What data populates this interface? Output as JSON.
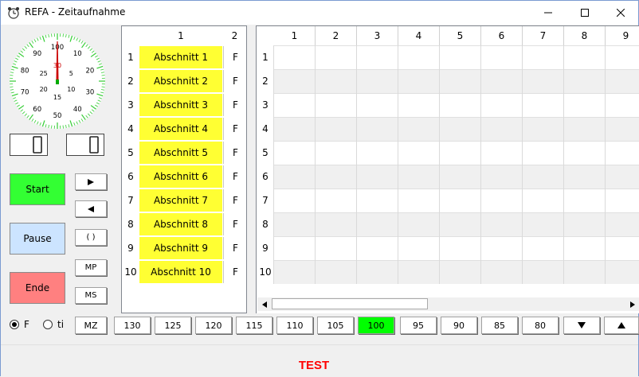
{
  "window": {
    "title": "REFA - Zeitaufnahme"
  },
  "stopwatch": {
    "outer_labels": [
      "100",
      "10",
      "20",
      "30",
      "40",
      "50",
      "60",
      "70",
      "80",
      "90"
    ],
    "inner_labels": [
      "30",
      "5",
      "10",
      "15",
      "20",
      "25"
    ],
    "display_left": "0",
    "display_right": "0"
  },
  "controls": {
    "start": "Start",
    "pause": "Pause",
    "ende": "Ende",
    "colors": {
      "start": "#33ff33",
      "pause": "#cce4ff",
      "ende": "#ff8080"
    }
  },
  "side_buttons": {
    "forward_icon": "play-right-icon",
    "back_icon": "play-left-icon",
    "parens": "( )",
    "mp": "MP",
    "ms": "MS"
  },
  "left_grid": {
    "headers": [
      "1",
      "2"
    ],
    "rows": [
      {
        "num": "1",
        "label": "Abschnitt 1",
        "f": "F"
      },
      {
        "num": "2",
        "label": "Abschnitt 2",
        "f": "F"
      },
      {
        "num": "3",
        "label": "Abschnitt 3",
        "f": "F"
      },
      {
        "num": "4",
        "label": "Abschnitt 4",
        "f": "F"
      },
      {
        "num": "5",
        "label": "Abschnitt 5",
        "f": "F"
      },
      {
        "num": "6",
        "label": "Abschnitt 6",
        "f": "F"
      },
      {
        "num": "7",
        "label": "Abschnitt 7",
        "f": "F"
      },
      {
        "num": "8",
        "label": "Abschnitt 8",
        "f": "F"
      },
      {
        "num": "9",
        "label": "Abschnitt 9",
        "f": "F"
      },
      {
        "num": "10",
        "label": "Abschnitt 10",
        "f": "F"
      }
    ]
  },
  "right_grid": {
    "headers": [
      "1",
      "2",
      "3",
      "4",
      "5",
      "6",
      "7",
      "8",
      "9"
    ],
    "row_numbers": [
      "1",
      "2",
      "3",
      "4",
      "5",
      "6",
      "7",
      "8",
      "9",
      "10"
    ]
  },
  "mode_radio": {
    "f": "F",
    "ti": "ti",
    "selected": "F"
  },
  "rating_buttons": {
    "mz": "MZ",
    "values": [
      "130",
      "125",
      "120",
      "115",
      "110",
      "105",
      "100",
      "95",
      "90",
      "85",
      "80"
    ],
    "selected": "100",
    "down_icon": "triangle-down-icon",
    "up_icon": "triangle-up-icon"
  },
  "status": {
    "text": "TEST"
  }
}
